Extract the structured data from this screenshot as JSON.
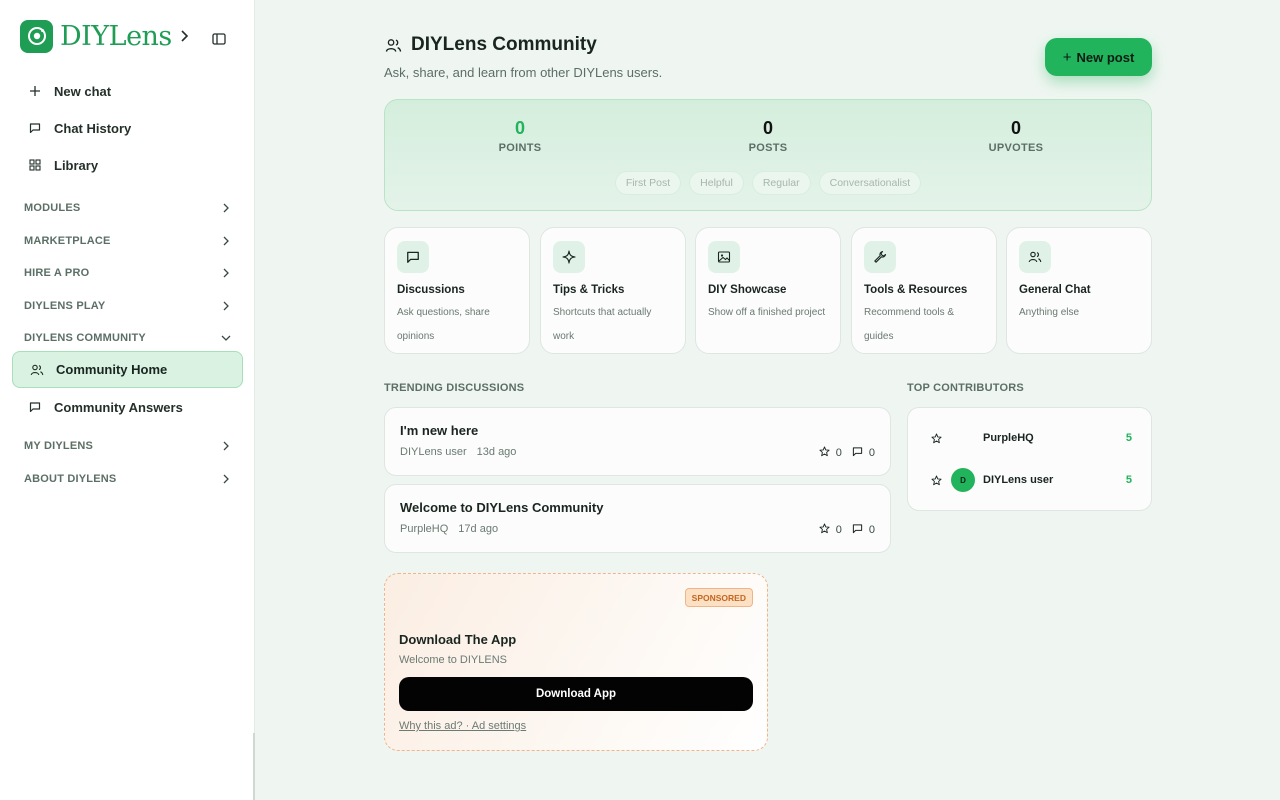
{
  "app": {
    "brand": "DIYLens"
  },
  "sidebar": {
    "primary": [
      {
        "label": "New chat",
        "icon": "plus-icon"
      },
      {
        "label": "Chat History",
        "icon": "chat-bubble-icon"
      },
      {
        "label": "Library",
        "icon": "grid-icon"
      }
    ],
    "sections": [
      {
        "label": "MODULES",
        "expanded": false
      },
      {
        "label": "MARKETPLACE",
        "expanded": false
      },
      {
        "label": "HIRE A PRO",
        "expanded": false
      },
      {
        "label": "DIYLENS PLAY",
        "expanded": false
      },
      {
        "label": "DIYLENS COMMUNITY",
        "expanded": true
      },
      {
        "label": "MY DIYLENS",
        "expanded": false
      },
      {
        "label": "ABOUT DIYLENS",
        "expanded": false
      }
    ],
    "community_items": [
      {
        "label": "Community Home",
        "active": true
      },
      {
        "label": "Community Answers",
        "active": false
      }
    ]
  },
  "header": {
    "title": "DIYLens Community",
    "subtitle": "Ask, share, and learn from other DIYLens users.",
    "new_post_label": "New post",
    "new_post_plus": "+"
  },
  "stats": {
    "points": {
      "value": "0",
      "label": "POINTS"
    },
    "posts": {
      "value": "0",
      "label": "POSTS"
    },
    "upvotes": {
      "value": "0",
      "label": "UPVOTES"
    },
    "badges": [
      "First Post",
      "Helpful",
      "Regular",
      "Conversationalist"
    ]
  },
  "categories": [
    {
      "title": "Discussions",
      "desc": "Ask questions, share opinions",
      "icon": "chat-bubble-icon"
    },
    {
      "title": "Tips & Tricks",
      "desc": "Shortcuts that actually work",
      "icon": "sparkle-icon"
    },
    {
      "title": "DIY Showcase",
      "desc": "Show off a finished project",
      "icon": "image-icon"
    },
    {
      "title": "Tools & Resources",
      "desc": "Recommend tools & guides",
      "icon": "wrench-icon"
    },
    {
      "title": "General Chat",
      "desc": "Anything else",
      "icon": "users-icon"
    }
  ],
  "trending": {
    "heading": "TRENDING DISCUSSIONS",
    "items": [
      {
        "title": "I'm new here",
        "author": "DIYLens user",
        "time": "13d ago",
        "stars": "0",
        "comments": "0"
      },
      {
        "title": "Welcome to DIYLens Community",
        "author": "PurpleHQ",
        "time": "17d ago",
        "stars": "0",
        "comments": "0"
      }
    ]
  },
  "contributors": {
    "heading": "TOP CONTRIBUTORS",
    "items": [
      {
        "name": "PurpleHQ",
        "points": "5",
        "avatar_letter": "",
        "avatar_color": "#fbfcfb"
      },
      {
        "name": "DIYLens user",
        "points": "5",
        "avatar_letter": "D",
        "avatar_color": "#22b35d"
      }
    ]
  },
  "sponsored": {
    "badge": "SPONSORED",
    "title": "Download The App",
    "subtitle": "Welcome to DIYLENS",
    "button": "Download App",
    "link": "Why this ad? · Ad settings"
  },
  "colors": {
    "accent": "#22b35d",
    "brand": "#1f9d55",
    "active_bg": "#d9f2e1"
  }
}
